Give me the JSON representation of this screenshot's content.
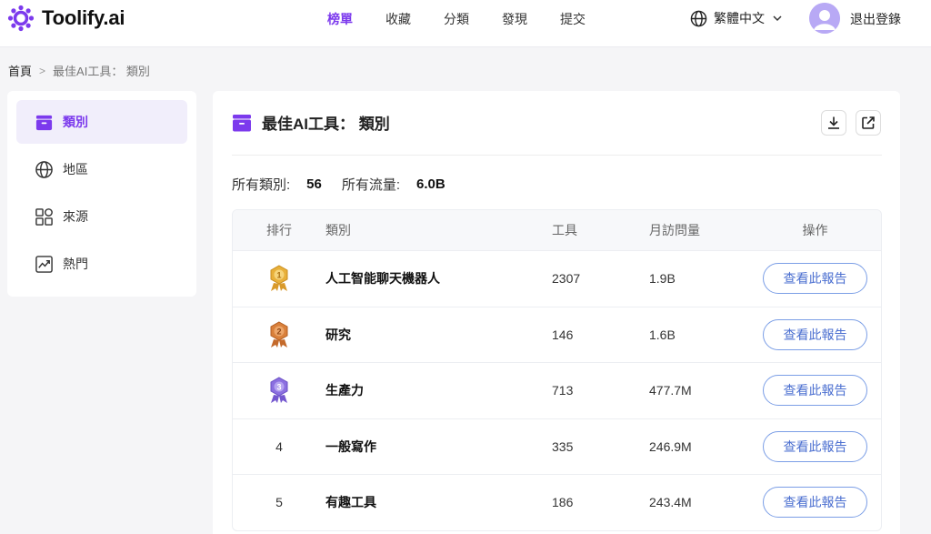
{
  "header": {
    "brand": "Toolify.ai",
    "nav": [
      {
        "label": "榜單",
        "active": true
      },
      {
        "label": "收藏",
        "active": false
      },
      {
        "label": "分類",
        "active": false
      },
      {
        "label": "發現",
        "active": false
      },
      {
        "label": "提交",
        "active": false
      }
    ],
    "language": "繁體中文",
    "logout": "退出登錄"
  },
  "breadcrumb": {
    "home": "首頁",
    "separator": ">",
    "current": "最佳AI工具： 類別"
  },
  "sidebar": {
    "items": [
      {
        "label": "類別",
        "icon": "folder-icon",
        "active": true
      },
      {
        "label": "地區",
        "icon": "globe-icon",
        "active": false
      },
      {
        "label": "來源",
        "icon": "shapes-icon",
        "active": false
      },
      {
        "label": "熱門",
        "icon": "trending-icon",
        "active": false
      }
    ]
  },
  "main": {
    "title": "最佳AI工具： 類別",
    "stats": {
      "categories_label": "所有類別:",
      "categories_value": "56",
      "traffic_label": "所有流量:",
      "traffic_value": "6.0B"
    },
    "table": {
      "headers": [
        "排行",
        "類別",
        "工具",
        "月訪問量",
        "操作"
      ],
      "rows": [
        {
          "rank": "1",
          "medal": "gold",
          "category": "人工智能聊天機器人",
          "tools": "2307",
          "visits": "1.9B",
          "action": "查看此報告"
        },
        {
          "rank": "2",
          "medal": "bronze",
          "category": "研究",
          "tools": "146",
          "visits": "1.6B",
          "action": "查看此報告"
        },
        {
          "rank": "3",
          "medal": "purple",
          "category": "生產力",
          "tools": "713",
          "visits": "477.7M",
          "action": "查看此報告"
        },
        {
          "rank": "4",
          "medal": "",
          "category": "一般寫作",
          "tools": "335",
          "visits": "246.9M",
          "action": "查看此報告"
        },
        {
          "rank": "5",
          "medal": "",
          "category": "有趣工具",
          "tools": "186",
          "visits": "243.4M",
          "action": "查看此報告"
        }
      ]
    }
  },
  "colors": {
    "accent": "#7c3aed",
    "button_text": "#4b6fd0",
    "gold": "#e8b03a",
    "bronze": "#d9803b",
    "purple": "#8b6fe0"
  }
}
